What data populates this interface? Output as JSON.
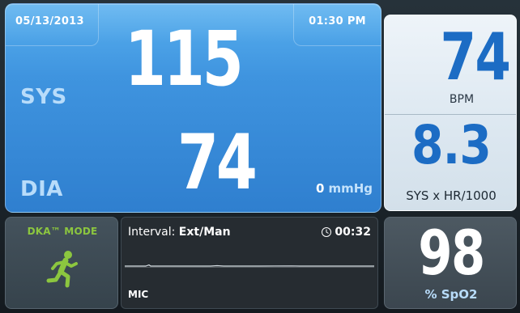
{
  "bp": {
    "date": "05/13/2013",
    "time": "01:30 PM",
    "sys_label": "SYS",
    "sys_value": "115",
    "dia_label": "DIA",
    "dia_value": "74",
    "pressure_value": "0",
    "pressure_unit": "mmHg"
  },
  "heart_rate": {
    "value": "74",
    "unit": "BPM"
  },
  "shock_index": {
    "value": "8.3",
    "label": "SYS x HR/1000"
  },
  "dka": {
    "label": "DKA™ MODE",
    "icon": "running-person-icon",
    "color": "#8cc63f"
  },
  "interval": {
    "label": "Interval:",
    "value": "Ext/Man",
    "timer": "00:32",
    "timer_icon": "clock-icon",
    "source": "MIC"
  },
  "spo2": {
    "value": "98",
    "label": "% SpO2"
  },
  "colors": {
    "bp_panel": "#3f94df",
    "value_blue": "#1c6cc4",
    "label_light_blue": "#b8dcfa"
  }
}
